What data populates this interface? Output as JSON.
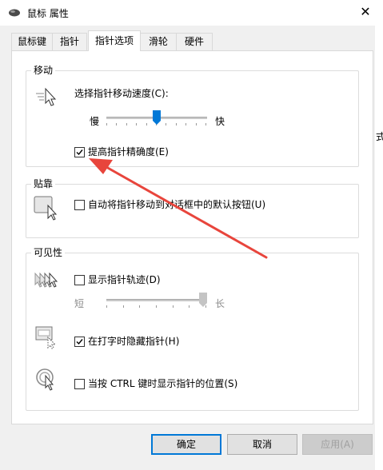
{
  "window": {
    "title": "鼠标 属性",
    "close_symbol": "✕"
  },
  "tabs": [
    {
      "label": "鼠标键"
    },
    {
      "label": "指针"
    },
    {
      "label": "指针选项",
      "active": true
    },
    {
      "label": "滑轮"
    },
    {
      "label": "硬件"
    }
  ],
  "motion": {
    "title": "移动",
    "speed_label": "选择指针移动速度(C):",
    "slow": "慢",
    "fast": "快",
    "speed_value": 0.5,
    "precision_label": "提高指针精确度(E)",
    "precision_checked": true
  },
  "snap": {
    "title": "贴靠",
    "snap_label": "自动将指针移动到对话框中的默认按钮(U)",
    "snap_checked": false
  },
  "visibility": {
    "title": "可见性",
    "trails_label": "显示指针轨迹(D)",
    "trails_checked": false,
    "short": "短",
    "long": "长",
    "trails_value": 1.0,
    "hide_label": "在打字时隐藏指针(H)",
    "hide_checked": true,
    "ctrl_label": "当按 CTRL 键时显示指针的位置(S)",
    "ctrl_checked": false
  },
  "buttons": {
    "ok": "确定",
    "cancel": "取消",
    "apply": "应用(A)"
  },
  "colors": {
    "accent": "#0078d7",
    "annotation_arrow": "#e8453c"
  },
  "background": {
    "marks": [
      "式"
    ]
  }
}
